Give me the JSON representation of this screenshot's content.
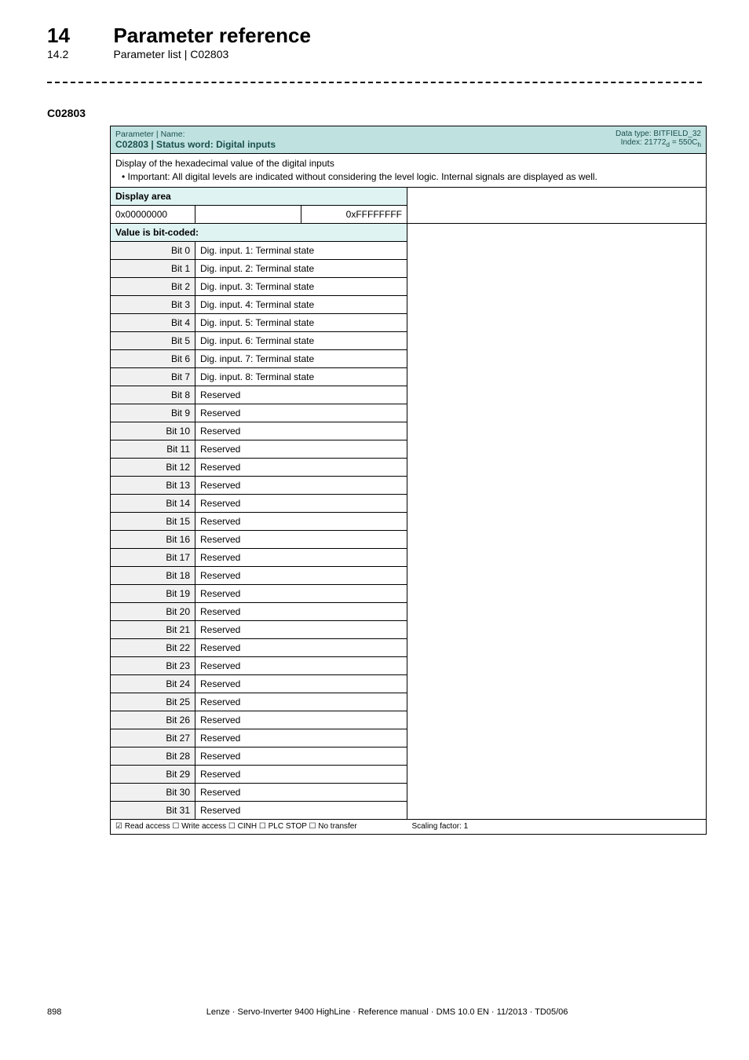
{
  "header": {
    "chapter_num": "14",
    "chapter_title": "Parameter reference",
    "section_num": "14.2",
    "section_title": "Parameter list | C02803"
  },
  "code_label": "C02803",
  "param_box": {
    "pn_label": "Parameter | Name:",
    "code_title": "C02803 | Status word: Digital inputs",
    "datatype_line1": "Data type: BITFIELD_32",
    "datatype_line2_prefix": "Index: 21772",
    "datatype_line2_sub1": "d",
    "datatype_line2_mid": " = 550C",
    "datatype_line2_sub2": "h",
    "desc_line1": "Display of the hexadecimal value of the digital inputs",
    "desc_bullet": "• Important: All digital levels are indicated without considering the level logic. Internal signals are displayed as well.",
    "display_area_label": "Display area",
    "display_low": "0x00000000",
    "display_high": "0xFFFFFFFF",
    "value_coded_label": "Value is bit-coded:",
    "bits": [
      {
        "bit": "Bit 0",
        "val": "Dig. input. 1: Terminal state"
      },
      {
        "bit": "Bit 1",
        "val": "Dig. input. 2: Terminal state"
      },
      {
        "bit": "Bit 2",
        "val": "Dig. input. 3: Terminal state"
      },
      {
        "bit": "Bit 3",
        "val": "Dig. input. 4: Terminal state"
      },
      {
        "bit": "Bit 4",
        "val": "Dig. input. 5: Terminal state"
      },
      {
        "bit": "Bit 5",
        "val": "Dig. input. 6: Terminal state"
      },
      {
        "bit": "Bit 6",
        "val": "Dig. input. 7: Terminal state"
      },
      {
        "bit": "Bit 7",
        "val": "Dig. input. 8: Terminal state"
      },
      {
        "bit": "Bit 8",
        "val": "Reserved"
      },
      {
        "bit": "Bit 9",
        "val": "Reserved"
      },
      {
        "bit": "Bit 10",
        "val": "Reserved"
      },
      {
        "bit": "Bit 11",
        "val": "Reserved"
      },
      {
        "bit": "Bit 12",
        "val": "Reserved"
      },
      {
        "bit": "Bit 13",
        "val": "Reserved"
      },
      {
        "bit": "Bit 14",
        "val": "Reserved"
      },
      {
        "bit": "Bit 15",
        "val": "Reserved"
      },
      {
        "bit": "Bit 16",
        "val": "Reserved"
      },
      {
        "bit": "Bit 17",
        "val": "Reserved"
      },
      {
        "bit": "Bit 18",
        "val": "Reserved"
      },
      {
        "bit": "Bit 19",
        "val": "Reserved"
      },
      {
        "bit": "Bit 20",
        "val": "Reserved"
      },
      {
        "bit": "Bit 21",
        "val": "Reserved"
      },
      {
        "bit": "Bit 22",
        "val": "Reserved"
      },
      {
        "bit": "Bit 23",
        "val": "Reserved"
      },
      {
        "bit": "Bit 24",
        "val": "Reserved"
      },
      {
        "bit": "Bit 25",
        "val": "Reserved"
      },
      {
        "bit": "Bit 26",
        "val": "Reserved"
      },
      {
        "bit": "Bit 27",
        "val": "Reserved"
      },
      {
        "bit": "Bit 28",
        "val": "Reserved"
      },
      {
        "bit": "Bit 29",
        "val": "Reserved"
      },
      {
        "bit": "Bit 30",
        "val": "Reserved"
      },
      {
        "bit": "Bit 31",
        "val": "Reserved"
      }
    ],
    "footer_left": "☑ Read access   ☐ Write access   ☐ CINH   ☐ PLC STOP   ☐ No transfer",
    "footer_right": "Scaling factor: 1"
  },
  "footer": {
    "page_num": "898",
    "text": "Lenze · Servo-Inverter 9400 HighLine · Reference manual · DMS 10.0 EN · 11/2013 · TD05/06"
  }
}
